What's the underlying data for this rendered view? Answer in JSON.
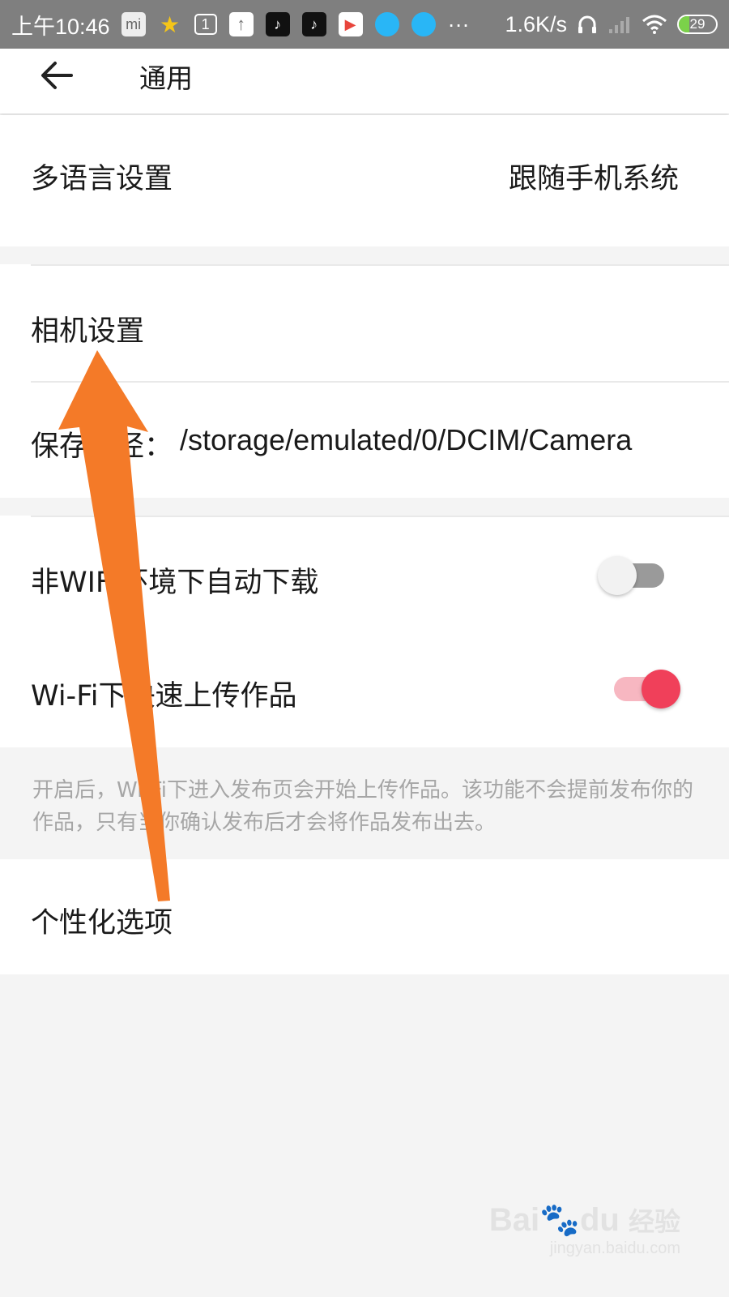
{
  "status_bar": {
    "time": "上午10:46",
    "network_speed": "1.6K/s",
    "battery": "29",
    "battery_level": 0.29,
    "dots": "···",
    "icons": [
      "mi-icon",
      "star-app-icon",
      "calendar-icon",
      "upload-icon",
      "tiktok-icon",
      "tiktok-icon",
      "play-store-icon",
      "blue-app-icon",
      "blue-app-icon",
      "headphone-icon",
      "signal-icon",
      "wifi-icon",
      "battery-icon"
    ]
  },
  "header": {
    "title": "通用",
    "back_icon": "back-arrow-icon"
  },
  "language": {
    "label": "多语言设置",
    "value": "跟随手机系统"
  },
  "camera": {
    "label": "相机设置",
    "save_path_label": "保存路径：",
    "save_path_value": "/storage/emulated/0/DCIM/Camera"
  },
  "download": {
    "non_wifi_label": "非WIFI环境下自动下载",
    "non_wifi_on": false,
    "wifi_upload_label": "Wi-Fi下快速上传作品",
    "wifi_upload_on": true,
    "hint": "开启后，Wi-Fi下进入发布页会开始上传作品。该功能不会提前发布你的作品，只有当你确认发布后才会将作品发布出去。"
  },
  "personalize": {
    "label": "个性化选项"
  },
  "watermark": {
    "brand": "Bai",
    "brand2": "du",
    "brand_cn": "经验",
    "url": "jingyan.baidu.com"
  },
  "colors": {
    "accent": "#f0405a",
    "accent_track": "#f7b7c1",
    "off_track": "#9a9a9a",
    "annotation_arrow": "#f47a28"
  }
}
